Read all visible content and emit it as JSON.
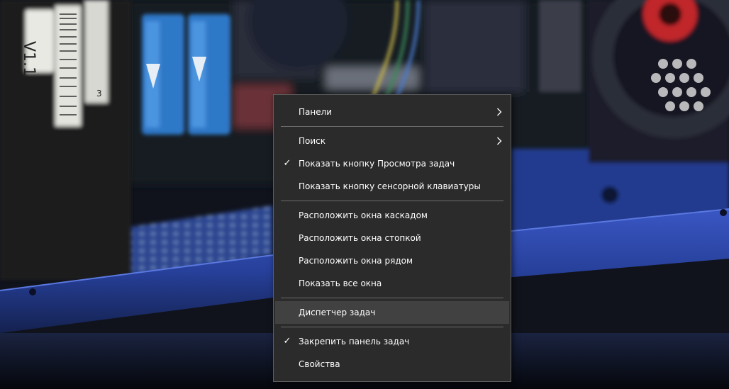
{
  "context_menu": {
    "groups": [
      {
        "items": [
          {
            "label": "Панели",
            "submenu": true
          }
        ]
      },
      {
        "items": [
          {
            "label": "Поиск",
            "submenu": true
          },
          {
            "label": "Показать кнопку Просмотра задач",
            "checked": true
          },
          {
            "label": "Показать кнопку сенсорной клавиатуры"
          }
        ]
      },
      {
        "items": [
          {
            "label": "Расположить окна каскадом"
          },
          {
            "label": "Расположить окна стопкой"
          },
          {
            "label": "Расположить окна рядом"
          },
          {
            "label": "Показать все окна"
          }
        ]
      },
      {
        "items": [
          {
            "label": "Диспетчер задач",
            "highlighted": true
          }
        ]
      },
      {
        "items": [
          {
            "label": "Закрепить панель задач",
            "checked": true
          },
          {
            "label": "Свойства"
          }
        ]
      }
    ],
    "check_glyph": "✓",
    "colors": {
      "menu_background": "#2b2b2b",
      "menu_border": "#5e5e5e",
      "hover_background": "#414141",
      "separator": "#6b6b6b",
      "text": "#ffffff"
    }
  },
  "wallpaper": {
    "module_label": "V1.1",
    "slot_label": "3",
    "colors": {
      "chassis_blue": "#27409a",
      "ram_blue": "#2f78c8",
      "fan_red": "#c0262c",
      "dark": "#0f1118"
    }
  }
}
